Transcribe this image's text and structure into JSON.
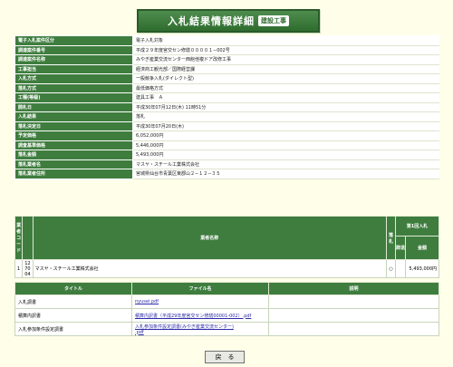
{
  "title": {
    "main": "入札結果情報詳細",
    "badge": "建設工事"
  },
  "info": [
    {
      "label": "電子入札案件区分",
      "value": "電子入札対象"
    },
    {
      "label": "調達案件番号",
      "value": "平成２９年度宮交セン修繕００００１−002号"
    },
    {
      "label": "調達案件名称",
      "value": "みやぎ産業交流センター西館他複ドア改修工事"
    },
    {
      "label": "工事担当",
      "value": "経済商工観光部／国際経営課"
    },
    {
      "label": "入札方式",
      "value": "一般競争入札(ダイレクト型)"
    },
    {
      "label": "落札方式",
      "value": "最低価格方式"
    },
    {
      "label": "工種(等級)",
      "value": "建具工事　Ａ"
    },
    {
      "label": "開札日",
      "value": "平成30年07月12日(木) 11時51分"
    },
    {
      "label": "入札結果",
      "value": "落札"
    },
    {
      "label": "落札決定日",
      "value": "平成30年07月20日(木)"
    },
    {
      "label": "予定価格",
      "value": "6,052,000円"
    },
    {
      "label": "調査基準価格",
      "value": "5,446,000円"
    },
    {
      "label": "落札金額",
      "value": "5,493,000円"
    },
    {
      "label": "落札業者名",
      "value": "マスヤ・スチール工業株式会社"
    },
    {
      "label": "落札業者住所",
      "value": "宮城県仙台市青葉区東郡山２−１２−３５"
    }
  ],
  "results": {
    "headers": {
      "col_no": "業者コード",
      "name": "業者名称",
      "result": "落札",
      "bid_group": "第1回入札",
      "withdraw": "辞退",
      "amount": "金額"
    },
    "rows": [
      {
        "code1": "12",
        "code2": "70",
        "code3": "04",
        "name": "マスヤ・スチール工業株式会社",
        "result": "○",
        "amount": "5,493,000円"
      }
    ]
  },
  "files": {
    "headers": {
      "title": "タイトル",
      "filename": "ファイル名",
      "note": "説明"
    },
    "rows": [
      {
        "title": "入札調書",
        "file": "nyusei.pdf"
      },
      {
        "title": "積算内訳書",
        "file": "積算内訳書（平成29年度宮交セン修繕00001-002）.pdf"
      },
      {
        "title": "入札参加条件設定調書",
        "file": "入札参加条件設定調書(みやぎ産業交流センター)",
        "file2": ".pdf"
      }
    ]
  },
  "back_button": "戻　る"
}
